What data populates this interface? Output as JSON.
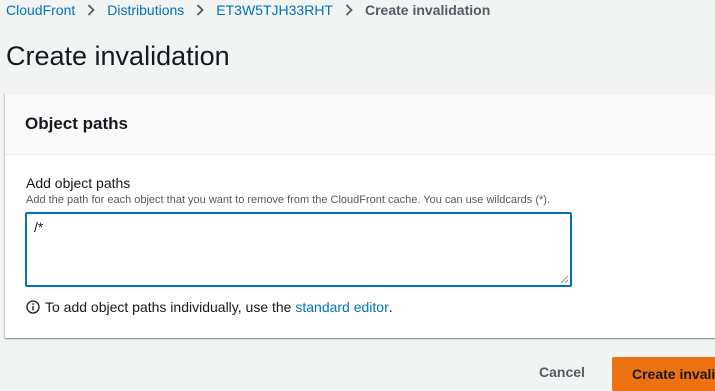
{
  "breadcrumb": {
    "items": [
      {
        "label": "CloudFront"
      },
      {
        "label": "Distributions"
      },
      {
        "label": "ET3W5TJH33RHT"
      }
    ],
    "current": "Create invalidation"
  },
  "page": {
    "title": "Create invalidation"
  },
  "panel": {
    "title": "Object paths",
    "field_label": "Add object paths",
    "field_description": "Add the path for each object that you want to remove from the CloudFront cache. You can use wildcards (*).",
    "textarea_value": "/*",
    "info_text": "To add object paths individually, use the",
    "info_link": "standard editor",
    "info_suffix": "."
  },
  "footer": {
    "cancel_label": "Cancel",
    "submit_label": "Create invalidation"
  },
  "colors": {
    "link": "#0073bb",
    "primary_button": "#ec7211",
    "background": "#f2f3f3"
  },
  "icons": {
    "breadcrumb_separator": "chevron-right-icon",
    "info": "info-circle-icon"
  }
}
